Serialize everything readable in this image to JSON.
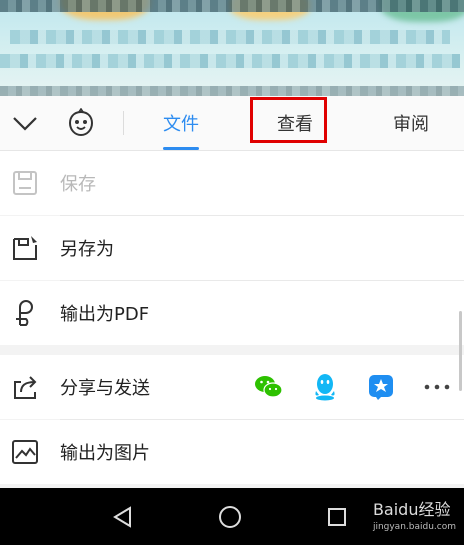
{
  "toolbar": {
    "tabs": [
      {
        "label": "文件",
        "active": true
      },
      {
        "label": "查看",
        "highlighted": true
      },
      {
        "label": "审阅"
      }
    ]
  },
  "menu": {
    "items": [
      {
        "label": "保存",
        "icon": "save-icon",
        "disabled": true
      },
      {
        "label": "另存为",
        "icon": "save-as-icon"
      },
      {
        "label": "输出为PDF",
        "icon": "pdf-icon"
      },
      {
        "label": "分享与发送",
        "icon": "share-icon"
      },
      {
        "label": "输出为图片",
        "icon": "image-icon"
      }
    ],
    "share_targets": [
      "wechat-icon",
      "qq-icon",
      "tim-icon",
      "more-icon"
    ]
  },
  "watermark": {
    "brand": "Baidu经验",
    "url": "jingyan.baidu.com"
  },
  "colors": {
    "accent": "#2d8cf0",
    "highlight": "#e00000",
    "wechat": "#2dc100",
    "qq": "#12b7f5",
    "tim": "#1f8ef1"
  }
}
